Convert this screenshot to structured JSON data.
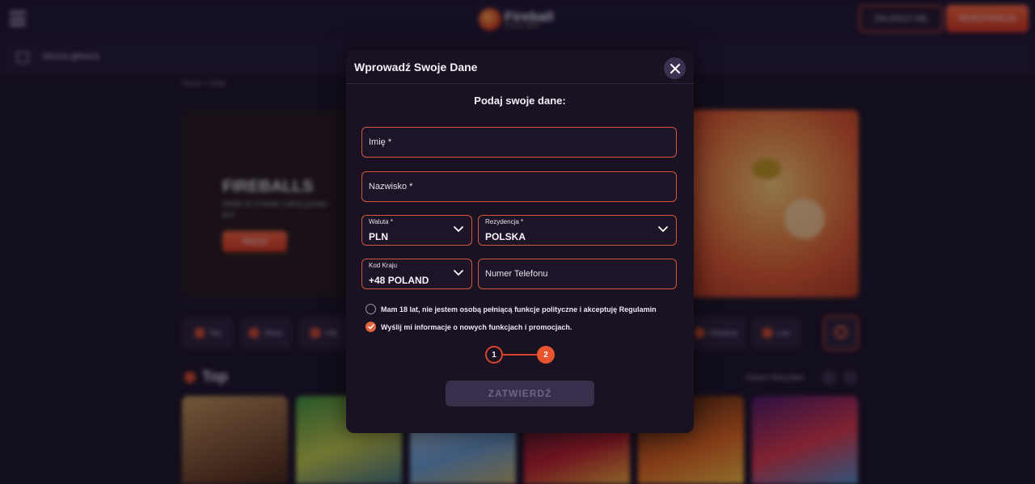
{
  "background": {
    "login_label": "ZALOGUJ SIĘ",
    "register_label": "REJESTRACJA",
    "home_label": "Strona główna",
    "breadcrumb": "Home > Slots",
    "hero": {
      "title": "FIREBALLS",
      "description": "Wejdź do Fireball i odkryj gorące gry!",
      "button": "Więcej"
    },
    "categories": [
      "Top",
      "Nowe",
      "Hity"
    ],
    "categories_right": [
      "Ulubione",
      "Live"
    ],
    "section_title": "Top",
    "see_all": "Zobacz Wszystkie"
  },
  "logo": {
    "name": "Fireball",
    "sub": "CASINO"
  },
  "modal": {
    "title": "Wprowadź Swoje Dane",
    "subtitle": "Podaj swoje dane:",
    "first_name_placeholder": "Imię *",
    "last_name_placeholder": "Nazwisko *",
    "currency": {
      "label": "Waluta *",
      "value": "PLN"
    },
    "residence": {
      "label": "Rezydencja *",
      "value": "POLSKA"
    },
    "country_code": {
      "label": "Kod Kraju",
      "value": "+48 POLAND"
    },
    "phone_placeholder": "Numer Telefonu",
    "consent_age": {
      "label": "Mam 18 lat, nie jestem osobą pełniącą funkcje polityczne i akceptuję Regulamin",
      "checked": false
    },
    "consent_marketing": {
      "label": "Wyślij mi informacje o nowych funkcjach i promocjach.",
      "checked": true
    },
    "steps": [
      "1",
      "2"
    ],
    "current_step": 2,
    "submit_label": "ZATWIERDŹ"
  },
  "colors": {
    "accent": "#e2633c",
    "modal_bg": "#1a1223",
    "page_bg": "#1b1426"
  }
}
